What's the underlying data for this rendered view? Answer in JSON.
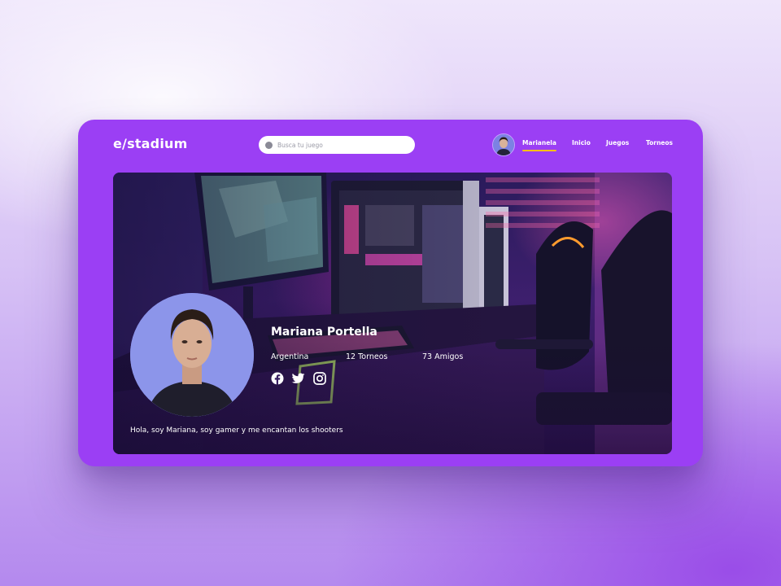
{
  "app": {
    "logo": "e/stadium"
  },
  "search": {
    "placeholder": "Busca tu juego"
  },
  "nav": {
    "user": "Marianela",
    "items": [
      {
        "label": "Inicio"
      },
      {
        "label": "Juegos"
      },
      {
        "label": "Torneos"
      }
    ]
  },
  "profile": {
    "name": "Mariana Portella",
    "country": "Argentina",
    "tournaments": "12 Torneos",
    "friends": "73 Amigos",
    "bio": "Hola, soy Mariana, soy gamer y me encantan los shooters",
    "social": [
      "facebook-icon",
      "twitter-icon",
      "instagram-icon"
    ]
  },
  "colors": {
    "brand": "#9b3ff4",
    "nav_underline": "#ffc107",
    "background": "#d7c2f5"
  }
}
